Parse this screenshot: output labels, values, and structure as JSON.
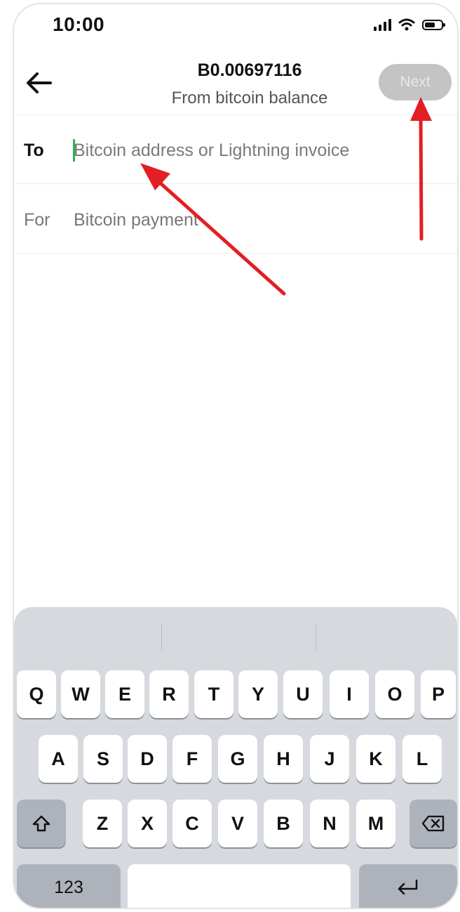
{
  "status_bar": {
    "time": "10:00"
  },
  "header": {
    "amount": "B0.00697116",
    "subtitle": "From bitcoin balance",
    "next_label": "Next"
  },
  "form": {
    "to_label": "To",
    "to_placeholder": "Bitcoin address or Lightning invoice",
    "to_value": "",
    "for_label": "For",
    "for_value": "Bitcoin payment"
  },
  "keyboard": {
    "row1": [
      "Q",
      "W",
      "E",
      "R",
      "T",
      "Y",
      "U",
      "I",
      "O",
      "P"
    ],
    "row2": [
      "A",
      "S",
      "D",
      "F",
      "G",
      "H",
      "J",
      "K",
      "L"
    ],
    "row3": [
      "Z",
      "X",
      "C",
      "V",
      "B",
      "N",
      "M"
    ],
    "numbers_label": "123"
  },
  "icons": {
    "back": "arrow-left-icon",
    "shift": "shift-icon",
    "delete": "backspace-icon",
    "return": "return-icon"
  },
  "colors": {
    "annotation_arrow": "#e31e24",
    "next_disabled_bg": "#c4c4c4",
    "caret": "#2fb44a",
    "keyboard_bg": "#d6d9de"
  }
}
